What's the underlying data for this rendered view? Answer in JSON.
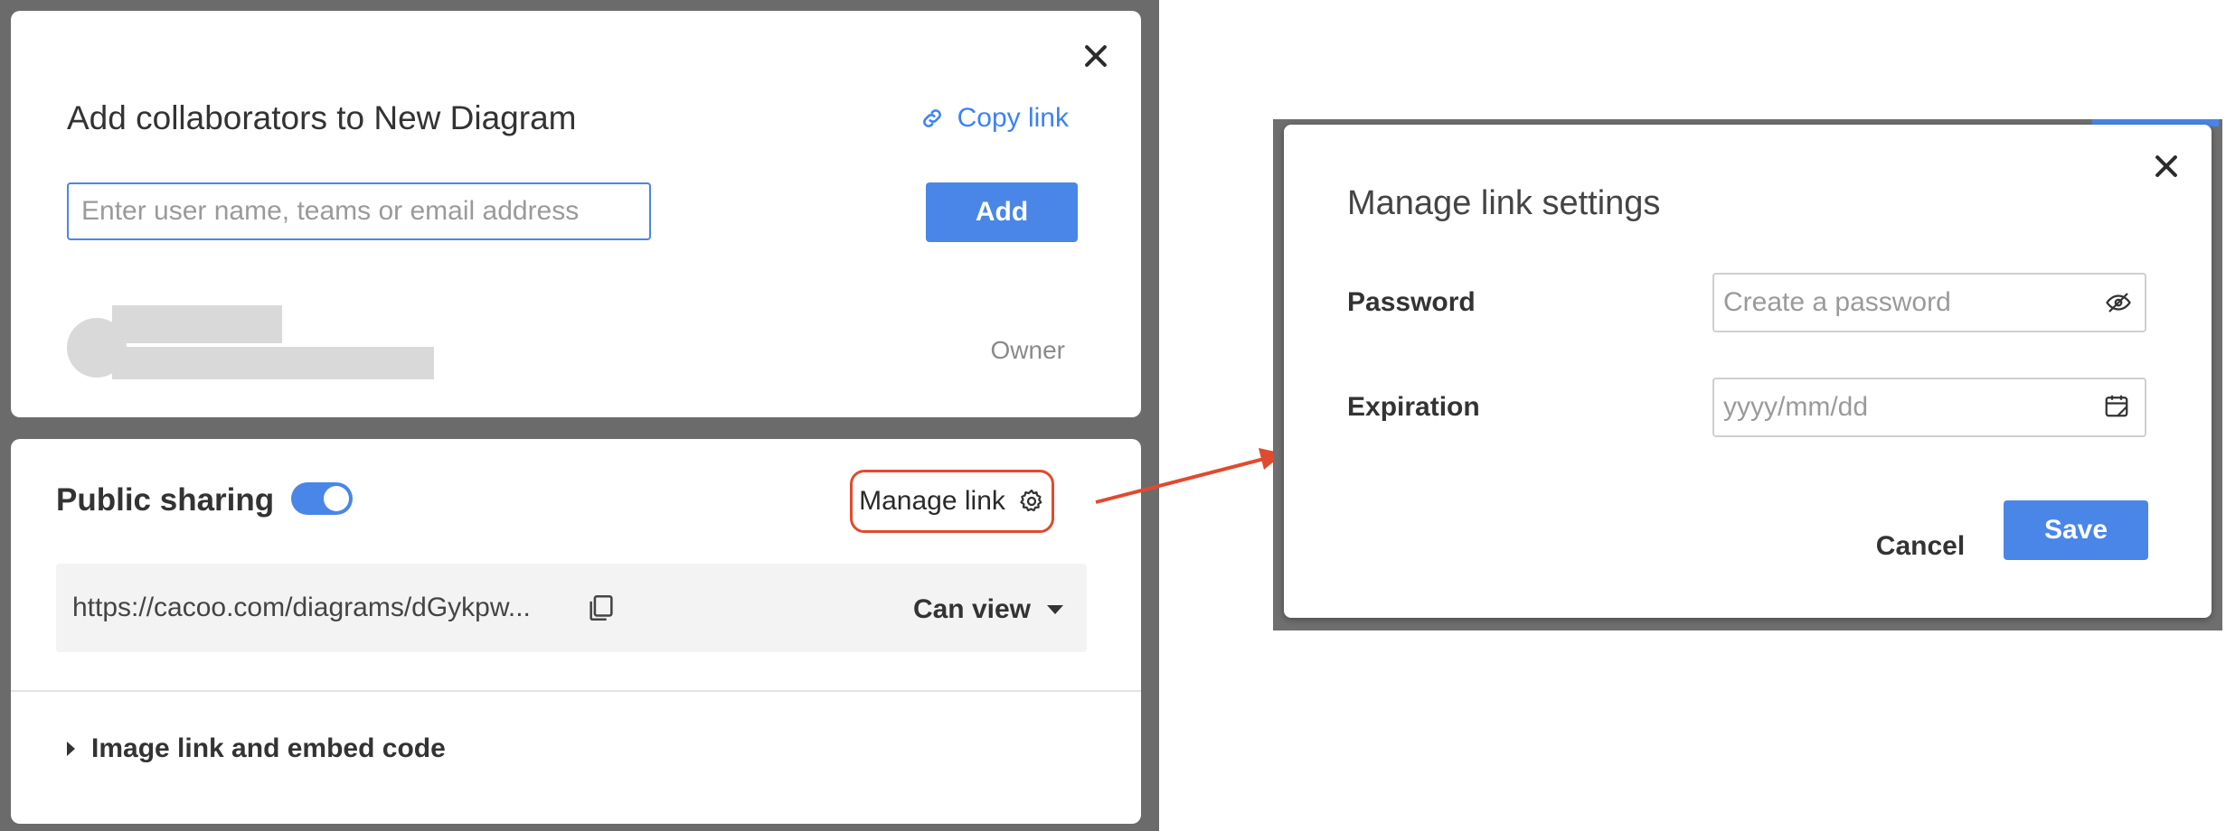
{
  "share_dialog": {
    "title": "Add collaborators to New Diagram",
    "copy_link_label": "Copy link",
    "search_placeholder": "Enter user name, teams or email address",
    "add_button": "Add",
    "member_role": "Owner"
  },
  "public_sharing": {
    "label": "Public sharing",
    "enabled": true,
    "manage_link_label": "Manage link",
    "url": "https://cacoo.com/diagrams/dGykpw...",
    "permission": "Can view",
    "embed_label": "Image link and embed code"
  },
  "manage_link_modal": {
    "title": "Manage link settings",
    "password_label": "Password",
    "password_placeholder": "Create a password",
    "expiration_label": "Expiration",
    "expiration_placeholder": "yyyy/mm/dd",
    "cancel_button": "Cancel",
    "save_button": "Save"
  },
  "colors": {
    "accent": "#4a86e8",
    "highlight": "#e04a2f"
  }
}
